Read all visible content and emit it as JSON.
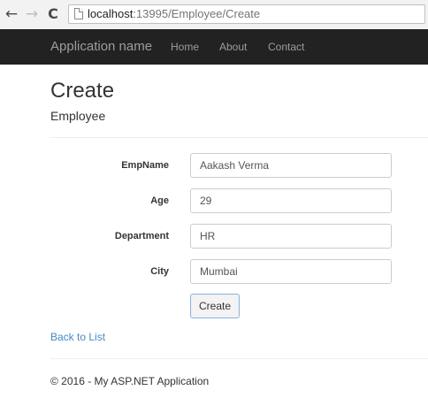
{
  "browser": {
    "back_glyph": "←",
    "forward_glyph": "→",
    "reload_glyph": "C",
    "url_host": "localhost",
    "url_path": ":13995/Employee/Create"
  },
  "navbar": {
    "brand": "Application name",
    "links": [
      "Home",
      "About",
      "Contact"
    ],
    "background": "#222222"
  },
  "page": {
    "title": "Create",
    "subtitle": "Employee"
  },
  "form": {
    "fields": [
      {
        "label": "EmpName",
        "value": "Aakash Verma"
      },
      {
        "label": "Age",
        "value": "29"
      },
      {
        "label": "Department",
        "value": "HR"
      },
      {
        "label": "City",
        "value": "Mumbai"
      }
    ],
    "submit_label": "Create"
  },
  "back_link": "Back to List",
  "footer": "© 2016 - My ASP.NET Application",
  "colors": {
    "link": "#428bca"
  }
}
